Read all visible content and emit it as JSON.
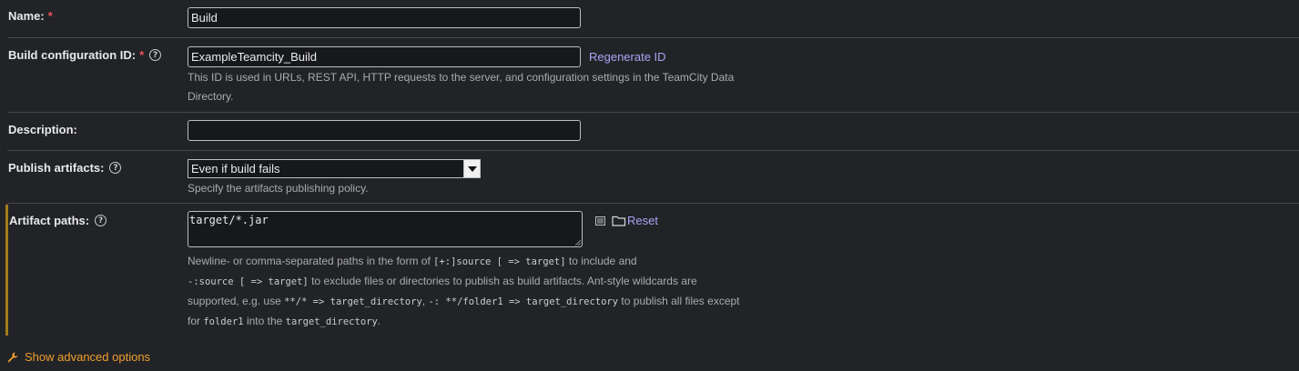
{
  "name_field": {
    "label": "Name:",
    "required_mark": "*",
    "value": "Build"
  },
  "config_id": {
    "label": "Build configuration ID:",
    "required_mark": "*",
    "value": "ExampleTeamcity_Build",
    "regenerate_label": "Regenerate ID",
    "note_line1": "This ID is used in URLs, REST API, HTTP requests to the server, and configuration settings in the TeamCity Data",
    "note_line2": "Directory."
  },
  "description": {
    "label": "Description:",
    "value": ""
  },
  "publish": {
    "label": "Publish artifacts:",
    "selected": "Even if build fails",
    "note": "Specify the artifacts publishing policy."
  },
  "artifacts": {
    "label": "Artifact paths:",
    "value": "target/*.jar",
    "reset_label": "Reset",
    "note": {
      "l1_a": "Newline- or comma-separated paths in the form of ",
      "l1_code": "[+:]source [ => target]",
      "l1_b": " to include and",
      "l2_code": "-:source [ => target]",
      "l2_b": " to exclude files or directories to publish as build artifacts. Ant-style wildcards are",
      "l3_a": "supported, e.g. use ",
      "l3_code1": "**/* => target_directory",
      "l3_b": ", ",
      "l3_code2": "-: **/folder1 => target_directory",
      "l3_c": " to publish all files except",
      "l4_a": "for ",
      "l4_code1": "folder1",
      "l4_b": " into the ",
      "l4_code2": "target_directory",
      "l4_c": "."
    }
  },
  "advanced": {
    "label": "Show advanced options"
  },
  "help_glyph": "?",
  "colors": {
    "link": "#a9a4f5",
    "accent_orange": "#f0a030",
    "required": "#f0505a",
    "artifact_bar": "#a37d1a"
  }
}
